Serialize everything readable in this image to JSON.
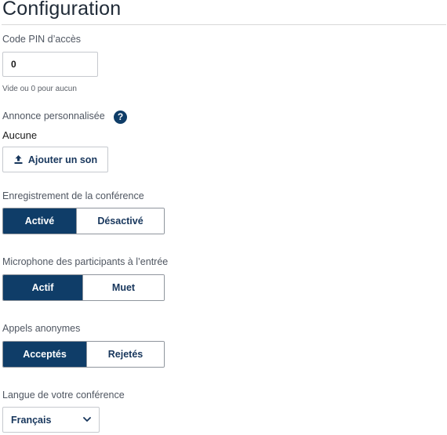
{
  "page": {
    "title": "Configuration"
  },
  "pin": {
    "label": "Code PIN d’accès",
    "value": "0",
    "hint": "Vide ou 0 pour aucun"
  },
  "announcement": {
    "label": "Annonce personnalisée",
    "help_icon": "?",
    "current": "Aucune",
    "add_button": "Ajouter un son",
    "add_icon": "upload-icon"
  },
  "recording": {
    "label": "Enregistrement de la conférence",
    "options": [
      "Activé",
      "Désactivé"
    ],
    "selected": "Activé"
  },
  "microphone": {
    "label": "Microphone des participants à l’entrée",
    "options": [
      "Actif",
      "Muet"
    ],
    "selected": "Actif"
  },
  "anonymous": {
    "label": "Appels anonymes",
    "options": [
      "Acceptés",
      "Rejetés"
    ],
    "selected": "Acceptés"
  },
  "language": {
    "label": "Langue de votre conférence",
    "selected": "Français",
    "icon": "chevron-down-icon"
  },
  "colors": {
    "primary": "#0f3d68",
    "text_dark": "#1a1a1a",
    "label": "#4f5661",
    "border": "#c6c9ce"
  }
}
